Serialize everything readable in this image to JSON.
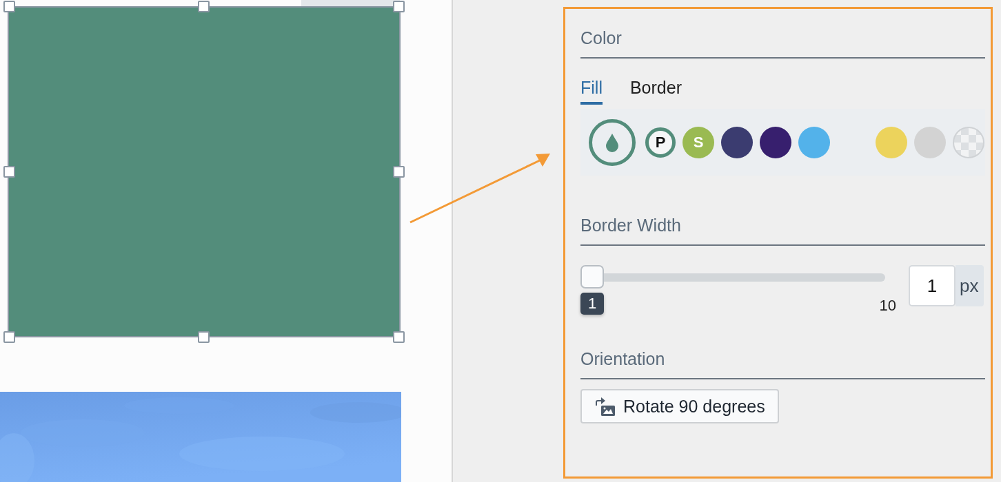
{
  "canvas": {
    "selected_shape": {
      "color": "#538d7b",
      "selected": true
    }
  },
  "color": {
    "title": "Color",
    "tabs": [
      {
        "label": "Fill",
        "selected": true
      },
      {
        "label": "Border",
        "selected": false
      }
    ],
    "swatches": [
      {
        "kind": "theme",
        "color": "#538d7b",
        "selected": true
      },
      {
        "kind": "letter",
        "text": "P",
        "color": "#538d7b",
        "selected": false
      },
      {
        "kind": "letter_filled",
        "text": "S",
        "color": "#9aba52",
        "selected": false
      },
      {
        "kind": "plain",
        "color": "#3b3c70",
        "selected": false
      },
      {
        "kind": "plain",
        "color": "#371f6e",
        "selected": false
      },
      {
        "kind": "plain",
        "color": "#53b2ea",
        "selected": false
      },
      {
        "kind": "plain",
        "color": "#ecd35c",
        "selected": false
      },
      {
        "kind": "plain",
        "color": "#d3d3d3",
        "selected": false
      },
      {
        "kind": "transparent",
        "selected": false
      }
    ]
  },
  "border_width": {
    "title": "Border Width",
    "level": 0,
    "value_label": "1",
    "max_label": "10",
    "input_value": "1",
    "unit": "px"
  },
  "orientation": {
    "title": "Orientation",
    "button": "Rotate 90 degrees"
  }
}
